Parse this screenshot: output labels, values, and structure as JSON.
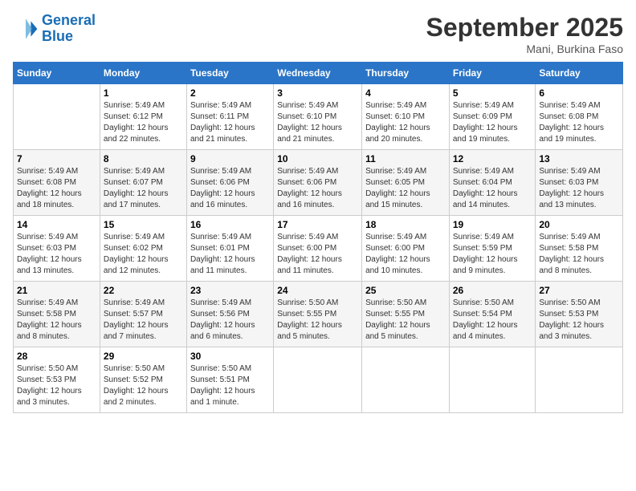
{
  "logo": {
    "line1": "General",
    "line2": "Blue"
  },
  "title": "September 2025",
  "subtitle": "Mani, Burkina Faso",
  "days_header": [
    "Sunday",
    "Monday",
    "Tuesday",
    "Wednesday",
    "Thursday",
    "Friday",
    "Saturday"
  ],
  "weeks": [
    [
      {
        "num": "",
        "detail": ""
      },
      {
        "num": "1",
        "detail": "Sunrise: 5:49 AM\nSunset: 6:12 PM\nDaylight: 12 hours\nand 22 minutes."
      },
      {
        "num": "2",
        "detail": "Sunrise: 5:49 AM\nSunset: 6:11 PM\nDaylight: 12 hours\nand 21 minutes."
      },
      {
        "num": "3",
        "detail": "Sunrise: 5:49 AM\nSunset: 6:10 PM\nDaylight: 12 hours\nand 21 minutes."
      },
      {
        "num": "4",
        "detail": "Sunrise: 5:49 AM\nSunset: 6:10 PM\nDaylight: 12 hours\nand 20 minutes."
      },
      {
        "num": "5",
        "detail": "Sunrise: 5:49 AM\nSunset: 6:09 PM\nDaylight: 12 hours\nand 19 minutes."
      },
      {
        "num": "6",
        "detail": "Sunrise: 5:49 AM\nSunset: 6:08 PM\nDaylight: 12 hours\nand 19 minutes."
      }
    ],
    [
      {
        "num": "7",
        "detail": "Sunrise: 5:49 AM\nSunset: 6:08 PM\nDaylight: 12 hours\nand 18 minutes."
      },
      {
        "num": "8",
        "detail": "Sunrise: 5:49 AM\nSunset: 6:07 PM\nDaylight: 12 hours\nand 17 minutes."
      },
      {
        "num": "9",
        "detail": "Sunrise: 5:49 AM\nSunset: 6:06 PM\nDaylight: 12 hours\nand 16 minutes."
      },
      {
        "num": "10",
        "detail": "Sunrise: 5:49 AM\nSunset: 6:06 PM\nDaylight: 12 hours\nand 16 minutes."
      },
      {
        "num": "11",
        "detail": "Sunrise: 5:49 AM\nSunset: 6:05 PM\nDaylight: 12 hours\nand 15 minutes."
      },
      {
        "num": "12",
        "detail": "Sunrise: 5:49 AM\nSunset: 6:04 PM\nDaylight: 12 hours\nand 14 minutes."
      },
      {
        "num": "13",
        "detail": "Sunrise: 5:49 AM\nSunset: 6:03 PM\nDaylight: 12 hours\nand 13 minutes."
      }
    ],
    [
      {
        "num": "14",
        "detail": "Sunrise: 5:49 AM\nSunset: 6:03 PM\nDaylight: 12 hours\nand 13 minutes."
      },
      {
        "num": "15",
        "detail": "Sunrise: 5:49 AM\nSunset: 6:02 PM\nDaylight: 12 hours\nand 12 minutes."
      },
      {
        "num": "16",
        "detail": "Sunrise: 5:49 AM\nSunset: 6:01 PM\nDaylight: 12 hours\nand 11 minutes."
      },
      {
        "num": "17",
        "detail": "Sunrise: 5:49 AM\nSunset: 6:00 PM\nDaylight: 12 hours\nand 11 minutes."
      },
      {
        "num": "18",
        "detail": "Sunrise: 5:49 AM\nSunset: 6:00 PM\nDaylight: 12 hours\nand 10 minutes."
      },
      {
        "num": "19",
        "detail": "Sunrise: 5:49 AM\nSunset: 5:59 PM\nDaylight: 12 hours\nand 9 minutes."
      },
      {
        "num": "20",
        "detail": "Sunrise: 5:49 AM\nSunset: 5:58 PM\nDaylight: 12 hours\nand 8 minutes."
      }
    ],
    [
      {
        "num": "21",
        "detail": "Sunrise: 5:49 AM\nSunset: 5:58 PM\nDaylight: 12 hours\nand 8 minutes."
      },
      {
        "num": "22",
        "detail": "Sunrise: 5:49 AM\nSunset: 5:57 PM\nDaylight: 12 hours\nand 7 minutes."
      },
      {
        "num": "23",
        "detail": "Sunrise: 5:49 AM\nSunset: 5:56 PM\nDaylight: 12 hours\nand 6 minutes."
      },
      {
        "num": "24",
        "detail": "Sunrise: 5:50 AM\nSunset: 5:55 PM\nDaylight: 12 hours\nand 5 minutes."
      },
      {
        "num": "25",
        "detail": "Sunrise: 5:50 AM\nSunset: 5:55 PM\nDaylight: 12 hours\nand 5 minutes."
      },
      {
        "num": "26",
        "detail": "Sunrise: 5:50 AM\nSunset: 5:54 PM\nDaylight: 12 hours\nand 4 minutes."
      },
      {
        "num": "27",
        "detail": "Sunrise: 5:50 AM\nSunset: 5:53 PM\nDaylight: 12 hours\nand 3 minutes."
      }
    ],
    [
      {
        "num": "28",
        "detail": "Sunrise: 5:50 AM\nSunset: 5:53 PM\nDaylight: 12 hours\nand 3 minutes."
      },
      {
        "num": "29",
        "detail": "Sunrise: 5:50 AM\nSunset: 5:52 PM\nDaylight: 12 hours\nand 2 minutes."
      },
      {
        "num": "30",
        "detail": "Sunrise: 5:50 AM\nSunset: 5:51 PM\nDaylight: 12 hours\nand 1 minute."
      },
      {
        "num": "",
        "detail": ""
      },
      {
        "num": "",
        "detail": ""
      },
      {
        "num": "",
        "detail": ""
      },
      {
        "num": "",
        "detail": ""
      }
    ]
  ]
}
